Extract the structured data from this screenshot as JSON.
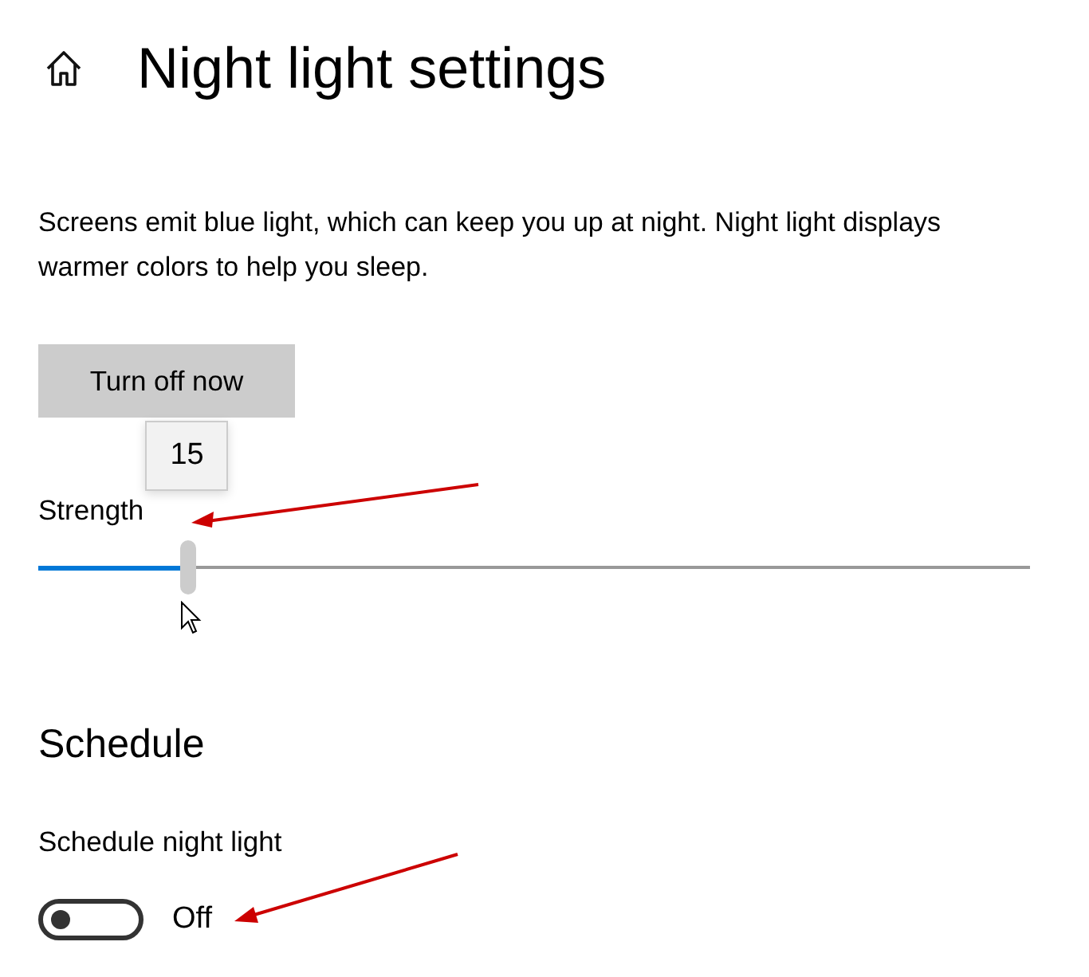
{
  "header": {
    "title": "Night light settings"
  },
  "description": "Screens emit blue light, which can keep you up at night. Night light displays warmer colors to help you sleep.",
  "turn_off_button": "Turn off now",
  "strength": {
    "label": "Strength",
    "level": 0.15,
    "tooltip": "15"
  },
  "schedule": {
    "heading": "Schedule",
    "toggle_label": "Schedule night light",
    "on": false,
    "state_text": "Off"
  }
}
